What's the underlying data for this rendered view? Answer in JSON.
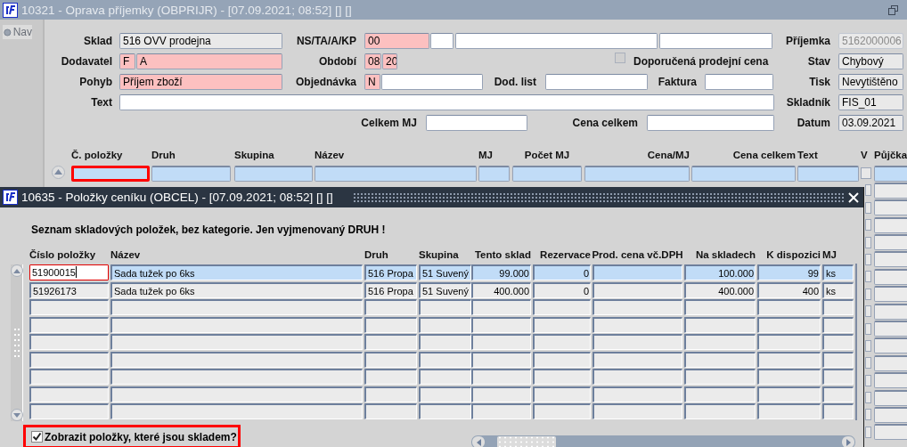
{
  "main_window": {
    "title": "10321 - Oprava příjemky (OBPRIJR) - [07.09.2021; 08:52] [] []",
    "nav_button": "Nav",
    "form_rows": [
      [
        {
          "kind": "label",
          "text": "Sklad"
        },
        {
          "kind": "readonly_field",
          "value": "516 OVV prodejna",
          "disabled": false
        },
        {
          "kind": "label",
          "text": "NS/TA/A/KP"
        },
        {
          "kind": "required_field",
          "value": "00",
          "disabled": false
        },
        {
          "kind": "field",
          "disabled": false
        },
        {
          "kind": "field",
          "disabled": false
        },
        {
          "kind": "field",
          "disabled": false
        },
        {
          "kind": "label",
          "text": "Příjemka"
        },
        {
          "kind": "readonly_field",
          "value": "5162000006",
          "disabled": true
        }
      ],
      [
        {
          "kind": "label",
          "text": "Dodavatel"
        },
        {
          "kind": "required_field",
          "value": "F",
          "disabled": false
        },
        {
          "kind": "required_field",
          "value": "A",
          "disabled": false
        },
        {
          "kind": "label",
          "text": "Období"
        },
        {
          "kind": "required_field",
          "value": "08",
          "disabled": false
        },
        {
          "kind": "required_field",
          "value": "20",
          "disabled": false
        },
        {
          "kind": "checkbox",
          "text": "Doporučená prodejní cena",
          "checked": false
        },
        {
          "kind": "label",
          "text": "Stav"
        },
        {
          "kind": "readonly_field",
          "value": "Chybový",
          "disabled": false
        }
      ],
      [
        {
          "kind": "label",
          "text": "Pohyb"
        },
        {
          "kind": "required_field",
          "value": "Příjem zboží",
          "disabled": false
        },
        {
          "kind": "label",
          "text": "Objednávka"
        },
        {
          "kind": "required_field",
          "value": "N",
          "disabled": false
        },
        {
          "kind": "field",
          "disabled": false
        },
        {
          "kind": "label",
          "text": "Dod. list"
        },
        {
          "kind": "field",
          "disabled": false
        },
        {
          "kind": "label",
          "text": "Faktura"
        },
        {
          "kind": "field",
          "disabled": false
        },
        {
          "kind": "label",
          "text": "Tisk"
        },
        {
          "kind": "readonly_field",
          "value": "Nevytištěno",
          "disabled": false
        }
      ],
      [
        {
          "kind": "label",
          "text": "Text"
        },
        {
          "kind": "field",
          "disabled": false
        },
        {
          "kind": "label",
          "text": "Skladník"
        },
        {
          "kind": "readonly_field",
          "value": "FIS_01",
          "disabled": false
        }
      ],
      [
        {
          "kind": "label",
          "text": "Celkem MJ"
        },
        {
          "kind": "field",
          "disabled": false
        },
        {
          "kind": "label",
          "text": "Cena celkem"
        },
        {
          "kind": "field",
          "disabled": false
        },
        {
          "kind": "label",
          "text": "Datum"
        },
        {
          "kind": "readonly_field",
          "value": "03.09.2021",
          "disabled": false
        }
      ]
    ],
    "item_columns": [
      {
        "label": "Č. položky",
        "highlighted": true
      },
      {
        "label": "Druh",
        "highlighted": false
      },
      {
        "label": "Skupina",
        "highlighted": false
      },
      {
        "label": "Název",
        "highlighted": false
      },
      {
        "label": "MJ",
        "highlighted": false
      },
      {
        "label": "Počet MJ",
        "highlighted": false
      },
      {
        "label": "Cena/MJ",
        "highlighted": false
      },
      {
        "label": "Cena celkem",
        "highlighted": false
      },
      {
        "label": "Text",
        "highlighted": false
      },
      {
        "label": "V",
        "highlighted": false
      },
      {
        "label": "Půjčka",
        "highlighted": false
      }
    ],
    "item_rows": [
      {
        "selected": true,
        "v_checked": false
      },
      {
        "selected": false,
        "v_checked": false
      },
      {
        "selected": false,
        "v_checked": false
      },
      {
        "selected": false,
        "v_checked": false
      },
      {
        "selected": false,
        "v_checked": false
      },
      {
        "selected": false,
        "v_checked": false
      },
      {
        "selected": false,
        "v_checked": false
      },
      {
        "selected": false,
        "v_checked": false
      },
      {
        "selected": false,
        "v_checked": false
      },
      {
        "selected": false,
        "v_checked": false
      },
      {
        "selected": false,
        "v_checked": false
      },
      {
        "selected": false,
        "v_checked": false
      },
      {
        "selected": false,
        "v_checked": false
      },
      {
        "selected": false,
        "v_checked": false
      },
      {
        "selected": false,
        "v_checked": false
      },
      {
        "selected": false,
        "v_checked": false
      }
    ]
  },
  "dialog": {
    "title": "10635 - Položky ceníku (OBCEL) - [07.09.2021; 08:52] [] []",
    "heading": "Seznam skladových položek, bez kategorie. Jen vyjmenovaný DRUH !",
    "columns": [
      "Číslo položky",
      "Název",
      "Druh",
      "Skupina",
      "Tento sklad",
      "Rezervace",
      "Prod. cena vč.DPH",
      "Na skladech",
      "K dispozici",
      "MJ"
    ],
    "rows": [
      {
        "selected": true,
        "cells": [
          "51900015",
          "Sada tužek po 6ks",
          "516 Propa",
          "51 Suvený",
          "99.000",
          "0",
          null,
          "100.000",
          "99",
          "ks"
        ]
      },
      {
        "selected": false,
        "cells": [
          "51926173",
          "Sada tužek po 6ks",
          "516 Propa",
          "51 Suvený",
          "400.000",
          "0",
          null,
          "400.000",
          "400",
          "ks"
        ]
      },
      {
        "selected": false
      },
      {
        "selected": false
      },
      {
        "selected": false
      },
      {
        "selected": false
      },
      {
        "selected": false
      },
      {
        "selected": false
      },
      {
        "selected": false
      }
    ],
    "stock_filter": {
      "label": "Zobrazit položky, které jsou skladem?",
      "checked": true,
      "highlighted": true
    }
  }
}
